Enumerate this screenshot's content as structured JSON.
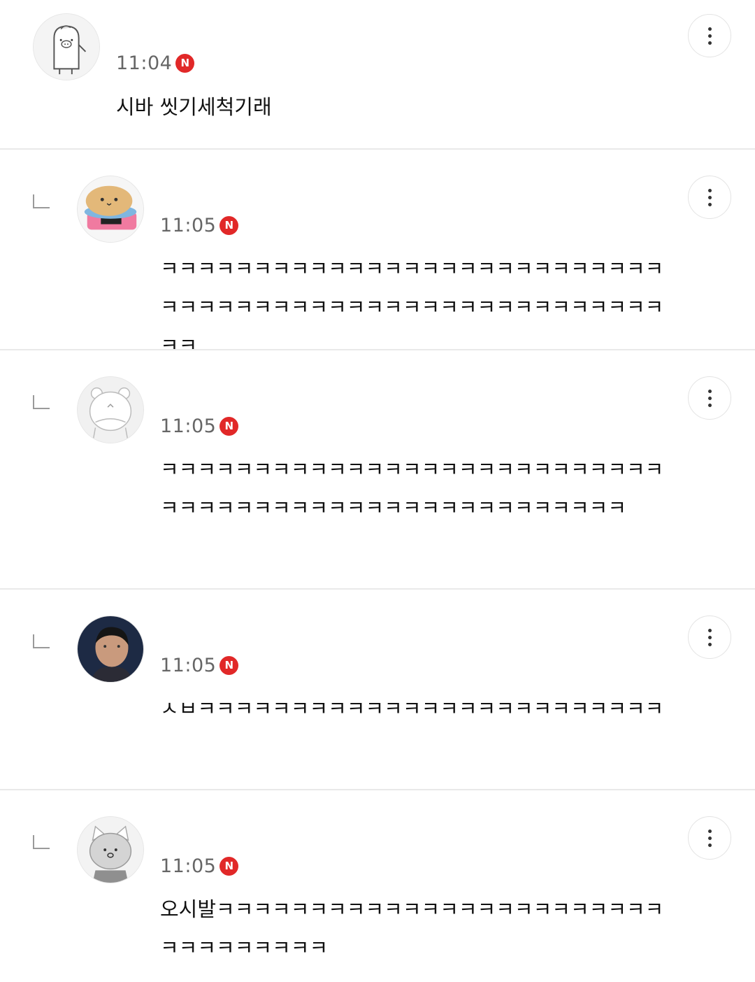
{
  "comments": [
    {
      "time": "11:04",
      "badge": "N",
      "text": "시바 씻기세척기래",
      "avatar_icon": "pig-character-icon",
      "is_reply": false
    },
    {
      "time": "11:05",
      "badge": "N",
      "text": "ㅋㅋㅋㅋㅋㅋㅋㅋㅋㅋㅋㅋㅋㅋㅋㅋㅋㅋㅋㅋㅋㅋㅋㅋㅋㅋㅋㅋㅋㅋㅋㅋㅋㅋㅋㅋㅋㅋㅋㅋㅋㅋㅋㅋㅋㅋㅋㅋㅋㅋㅋㅋㅋㅋㅋㅋ",
      "avatar_icon": "burger-character-icon",
      "is_reply": true
    },
    {
      "time": "11:05",
      "badge": "N",
      "text": "ㅋㅋㅋㅋㅋㅋㅋㅋㅋㅋㅋㅋㅋㅋㅋㅋㅋㅋㅋㅋㅋㅋㅋㅋㅋㅋㅋㅋㅋㅋㅋㅋㅋㅋㅋㅋㅋㅋㅋㅋㅋㅋㅋㅋㅋㅋㅋㅋㅋㅋㅋㅋ",
      "avatar_icon": "bear-character-icon",
      "is_reply": true
    },
    {
      "time": "11:05",
      "badge": "N",
      "text": "ㅅㅂㅋㅋㅋㅋㅋㅋㅋㅋㅋㅋㅋㅋㅋㅋㅋㅋㅋㅋㅋㅋㅋㅋㅋㅋㅋ",
      "avatar_icon": "person-photo-icon",
      "is_reply": true
    },
    {
      "time": "11:05",
      "badge": "N",
      "text": "오시발ㅋㅋㅋㅋㅋㅋㅋㅋㅋㅋㅋㅋㅋㅋㅋㅋㅋㅋㅋㅋㅋㅋㅋㅋㅋㅋㅋㅋㅋㅋㅋㅋㅋ",
      "avatar_icon": "cat-character-icon",
      "is_reply": true
    }
  ],
  "colors": {
    "badge_red": "#e12828",
    "divider": "#e9e9e9",
    "time_gray": "#666666"
  }
}
